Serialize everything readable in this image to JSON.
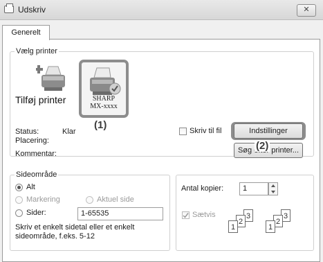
{
  "window": {
    "title": "Udskriv",
    "close_glyph": "✕"
  },
  "tabs": [
    {
      "label": "Generelt",
      "selected": true
    }
  ],
  "select_printer": {
    "legend": "Vælg printer",
    "items": [
      {
        "label": "Tilføj printer",
        "icon": "add-printer-icon"
      },
      {
        "label_line1": "SHARP",
        "label_line2": "MX-xxxx",
        "icon": "printer-icon",
        "selected": true
      }
    ],
    "callout_1": "(1)",
    "callout_2": "(2)",
    "status_label": "Status:",
    "status_value": "Klar",
    "location_label": "Placering:",
    "comment_label": "Kommentar:",
    "print_to_file": {
      "label": "Skriv til fil",
      "checked": false
    },
    "settings_button": "Indstillinger",
    "find_printer_button": "Søg efter printer..."
  },
  "page_range": {
    "legend": "Sideområde",
    "all": {
      "label": "Alt",
      "selected": true
    },
    "selection": {
      "label": "Markering",
      "enabled": false
    },
    "current_page": {
      "label": "Aktuel side",
      "enabled": false
    },
    "pages": {
      "label": "Sider:",
      "value": "1-65535"
    },
    "help_line1": "Skriv et enkelt sidetal eller et enkelt",
    "help_line2": "sideområde, f.eks. 5-12"
  },
  "copies": {
    "label": "Antal kopier:",
    "value": "1",
    "collate": {
      "label": "Sætvis",
      "checked": true,
      "enabled": false
    },
    "collate_pages": [
      "1",
      "2",
      "3"
    ]
  }
}
